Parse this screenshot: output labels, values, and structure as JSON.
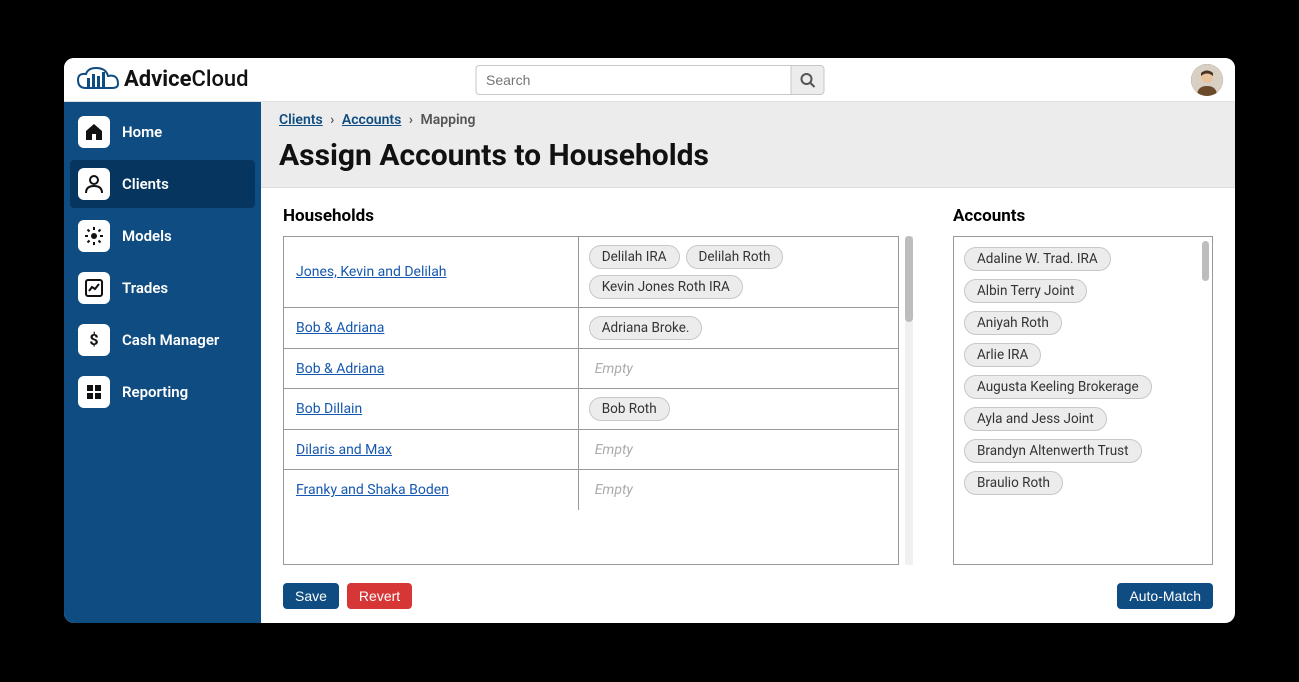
{
  "brand": {
    "name_bold": "Advice",
    "name_light": "Cloud"
  },
  "search": {
    "placeholder": "Search"
  },
  "sidebar": {
    "items": [
      {
        "label": "Home"
      },
      {
        "label": "Clients"
      },
      {
        "label": "Models"
      },
      {
        "label": "Trades"
      },
      {
        "label": "Cash Manager"
      },
      {
        "label": "Reporting"
      }
    ]
  },
  "breadcrumbs": {
    "a": "Clients",
    "b": "Accounts",
    "current": "Mapping"
  },
  "page_title": "Assign Accounts to Households",
  "households_title": "Households",
  "accounts_title": "Accounts",
  "empty_label": "Empty",
  "households": [
    {
      "name": "Jones, Kevin and Delilah",
      "accounts": [
        "Delilah IRA",
        "Delilah Roth",
        "Kevin Jones Roth IRA"
      ]
    },
    {
      "name": "Bob & Adriana",
      "accounts": [
        "Adriana Broke."
      ]
    },
    {
      "name": "Bob & Adriana",
      "accounts": []
    },
    {
      "name": "Bob Dillain",
      "accounts": [
        "Bob Roth"
      ]
    },
    {
      "name": "Dilaris and Max",
      "accounts": []
    },
    {
      "name": "Franky and Shaka Boden",
      "accounts": []
    }
  ],
  "unassigned_accounts": [
    "Adaline W. Trad. IRA",
    "Albin Terry Joint",
    "Aniyah Roth",
    "Arlie IRA",
    "Augusta Keeling Brokerage",
    "Ayla and Jess Joint",
    "Brandyn Altenwerth Trust",
    "Braulio Roth"
  ],
  "buttons": {
    "save": "Save",
    "revert": "Revert",
    "automatch": "Auto-Match"
  }
}
